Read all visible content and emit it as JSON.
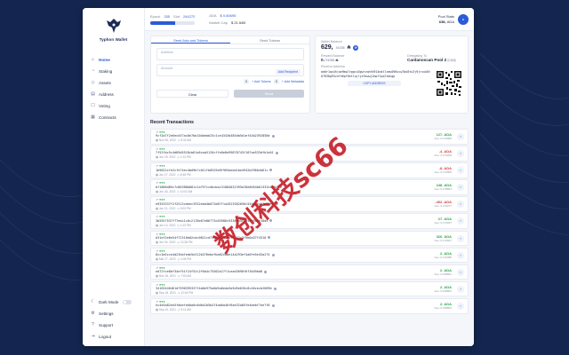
{
  "app_name": "Typhon Wallet",
  "colors": {
    "accent": "#2b5bd7",
    "positive": "#27a844",
    "negative": "#e03c3c",
    "background": "#14264f"
  },
  "sidebar": {
    "items": [
      {
        "label": "Home",
        "icon": "home-icon"
      },
      {
        "label": "Staking",
        "icon": "staking-icon"
      },
      {
        "label": "Assets",
        "icon": "assets-icon"
      },
      {
        "label": "Address",
        "icon": "address-icon"
      },
      {
        "label": "Voting",
        "icon": "voting-icon"
      },
      {
        "label": "Contracts",
        "icon": "contracts-icon"
      }
    ],
    "bottom": [
      {
        "label": "Dark Mode",
        "icon": "moon-icon"
      },
      {
        "label": "Settings",
        "icon": "gear-icon"
      },
      {
        "label": "Support",
        "icon": "support-icon"
      },
      {
        "label": "Logout",
        "icon": "logout-icon"
      }
    ]
  },
  "topbar": {
    "epoch_label": "Epoch",
    "epoch_value": "335",
    "slot_label": "Slot",
    "slot_value": "244272",
    "epoch_progress": 0.55,
    "ada_label": "ADA",
    "ada_value": "$ 0.60695",
    "mcap_label": "Market Cap",
    "mcap_value": "$ 21.54B",
    "pool_name": "Pool Stats",
    "pool_value": "638,",
    "pool_ticker": "ADA"
  },
  "send": {
    "tab_send": "Send Ada and Tokens",
    "tab_tokens": "Send Tokens",
    "address_placeholder": "Address",
    "amount_placeholder": "Amount",
    "add_recipient": "Add Recipient",
    "token_count": "0",
    "add_tokens": "+ Add Tokens",
    "meta_count": "0",
    "add_metadata": "+ Add Metadata",
    "clear": "Clear",
    "send": "Send"
  },
  "wallet": {
    "balance_label": "Wallet Balance",
    "balance": "629,",
    "balance_small": "41036",
    "reward_label": "Reward Balance",
    "reward": "0.",
    "reward_small": "721058",
    "delegating_label": "Delegating To",
    "pool": "Cardanoscan Pool 2",
    "pool_ticker": "[CAN]",
    "receive_label": "Receive Address",
    "receive_address": "addr1qx4hjwe9mp7vggcu3gwrvqhfd914m4tlcmu096xcw7bk8tu3j9jrxuk8t07836g93znfh6pf6ktlwjlyz9swwj2mp7tpq7sdugp",
    "copy_label": "COPY ADDRESS"
  },
  "recent_title": "Recent Transactions",
  "transactions": [
    {
      "hash": "9cf2d7f2e6ecd37ac8e7bb104bebb25c1ce4343d485db5d1ef44b2392858e",
      "date": "Nov 06, 2022",
      "time": "5:32 AM",
      "amount": "127.",
      "unit": "ADA",
      "fee": "Fee: 0.172805",
      "dir": "pos"
    },
    {
      "hash": "7f52fbc5c4d89d5518cb61a6caa5120cffe0e8e99878743f107ae533dfb1e01",
      "date": "Jun 29, 2022",
      "time": "1:13 PM",
      "amount": "-4.",
      "unit": "ADA",
      "fee": "Fee: 0.170209",
      "dir": "neg"
    },
    {
      "hash": "1b9022cfe2cfe74ec4bd9b7c011fb0529e8f965aeda1be4942b296b4d61c",
      "date": "Jun 27, 2022",
      "time": "8:48 PM",
      "amount": "-8.",
      "unit": "ADA",
      "fee": "Fee: 0.172805",
      "dir": "neg"
    },
    {
      "hash": "bf1806d85c7c86388b081c2a797ccdbcbac31884032395e28e8054b01332e1c5c",
      "date": "Jun 26, 2022",
      "time": "10:02 AM",
      "amount": "248.",
      "unit": "ADA",
      "fee": "Fee: 0.178801",
      "dir": "pos"
    },
    {
      "hash": "e9353337f2f2513cdeec3932ebd4b072d87f1a4523582656c55a01e4e0e21e0",
      "date": "Jun 21, 2022",
      "time": "5:03 PM",
      "amount": "-492.",
      "unit": "ADA",
      "fee": "Fee: 0.172277",
      "dir": "neg"
    },
    {
      "hash": "3b5927537f77edc1c6c2178e67e86773c03986c9336da5f585299a6e18d5",
      "date": "Jun 14, 2022",
      "time": "4:10 PM",
      "amount": "27.",
      "unit": "ADA",
      "fee": "Fee: 0.172937",
      "dir": "pos"
    },
    {
      "hash": "b31ef2e6e54f72310dd2cdc0821cd7188262b16c7f332c3f5b0a37f4310",
      "date": "Jun 04, 2022",
      "time": "12:36 PM",
      "amount": "326.",
      "unit": "ADA",
      "fee": "Fee: 0.172607",
      "dir": "pos"
    },
    {
      "hash": "8cc3a5cce4d23ebfede5e312b376ebefba82cbbe14a293ef4a0fe5e45a274",
      "date": "Mar 27, 2022",
      "time": "4:05 PM",
      "amount": "2.",
      "unit": "ADA",
      "fee": "Fee: 0.170385",
      "dir": "pos"
    },
    {
      "hash": "ed72fce6bf34ef51f24f52c2f6b4c75502e27f1cead3690f6f3049bd8",
      "date": "Dec 16, 2021",
      "time": "7:53 AM",
      "amount": "2.",
      "unit": "ADA",
      "fee": "Fee: 0.168801",
      "dir": "pos"
    },
    {
      "hash": "34163440461d7590395337f4a8e975a0d5a6eda3a5d5e626c8c46cecb2669b",
      "date": "Sep 18, 2021",
      "time": "12:44 PM",
      "amount": "2.",
      "unit": "ADA",
      "fee": "Fee: 0.168801",
      "dir": "pos"
    },
    {
      "hash": "ec4e5a82ee5fdbefeb0a0c0d6a2b5b474ab6a4bf6ae32a05fe4bebf7ee7f8",
      "date": "Sep 10, 2021",
      "time": "9:11 AM",
      "amount": "2.",
      "unit": "ADA",
      "fee": "Fee: 0.168801",
      "dir": "pos"
    }
  ],
  "watermark": "数创科技sc66"
}
